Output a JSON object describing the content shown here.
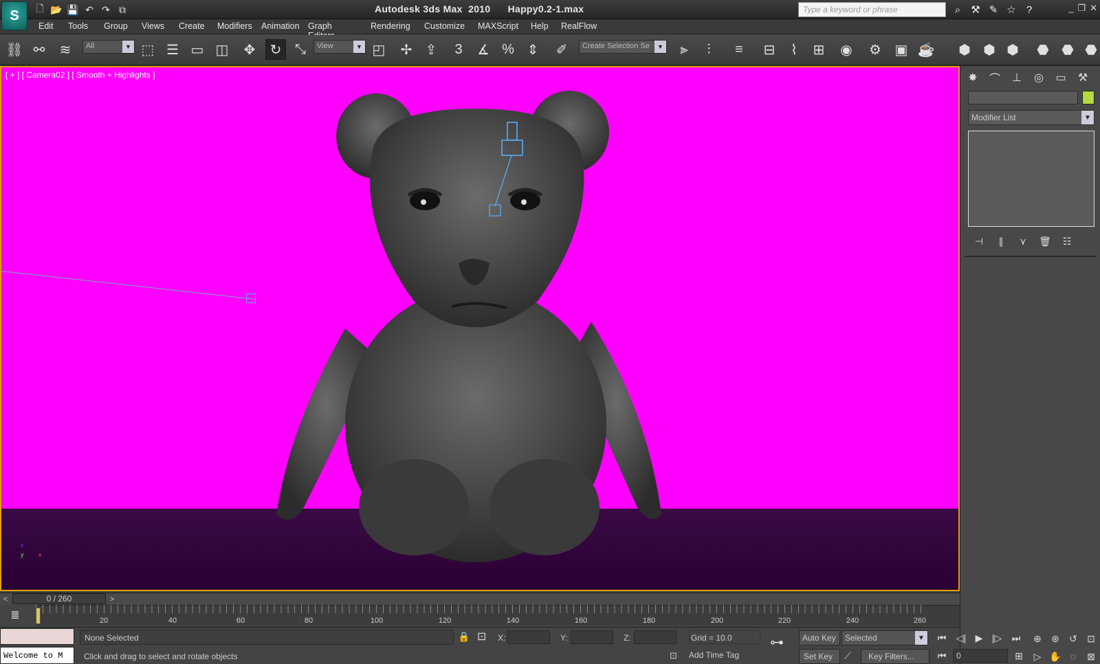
{
  "window": {
    "title": "Autodesk 3ds Max  2010      Happy0.2-1.max",
    "search_placeholder": "Type a keyword or phrase",
    "controls": [
      "_",
      "❐",
      "✕"
    ]
  },
  "quick_access": [
    "🗋",
    "📂",
    "💾",
    "↶",
    "↷",
    "⧉"
  ],
  "menu": [
    "Edit",
    "Tools",
    "Group",
    "Views",
    "Create",
    "Modifiers",
    "Animation",
    "Graph Editors",
    "Rendering",
    "Customize",
    "MAXScript",
    "Help",
    "RealFlow"
  ],
  "toolbar": {
    "selection_filter": "All",
    "ref_coord": "View",
    "named_selection": "Create Selection Se"
  },
  "viewport": {
    "label": "[ + ] [ Camera02 ] [ Smooth + Highlights ]",
    "background_color": "#ff00ff",
    "floor_color": "#2e0039",
    "border_color": "#e0a000",
    "gizmo": {
      "x": "x",
      "y": "y",
      "z": "z"
    }
  },
  "command_panel": {
    "modifier_list": "Modifier List",
    "color_swatch": "#b6d840"
  },
  "timeline": {
    "slider": "0 / 260",
    "ticks": [
      "20",
      "40",
      "60",
      "80",
      "100",
      "120",
      "140",
      "160",
      "180",
      "200",
      "220",
      "240",
      "260"
    ]
  },
  "status": {
    "maxscript_output": "Welcome to M",
    "selection": "None Selected",
    "prompt": "Click and drag to select and rotate objects",
    "x_label": "X:",
    "y_label": "Y:",
    "z_label": "Z:",
    "grid": "Grid = 10.0",
    "add_time_tag": "Add Time Tag",
    "auto_key": "Auto Key",
    "set_key": "Set Key",
    "key_mode": "Selected",
    "key_filters": "Key Filters...",
    "current_frame": "0"
  }
}
